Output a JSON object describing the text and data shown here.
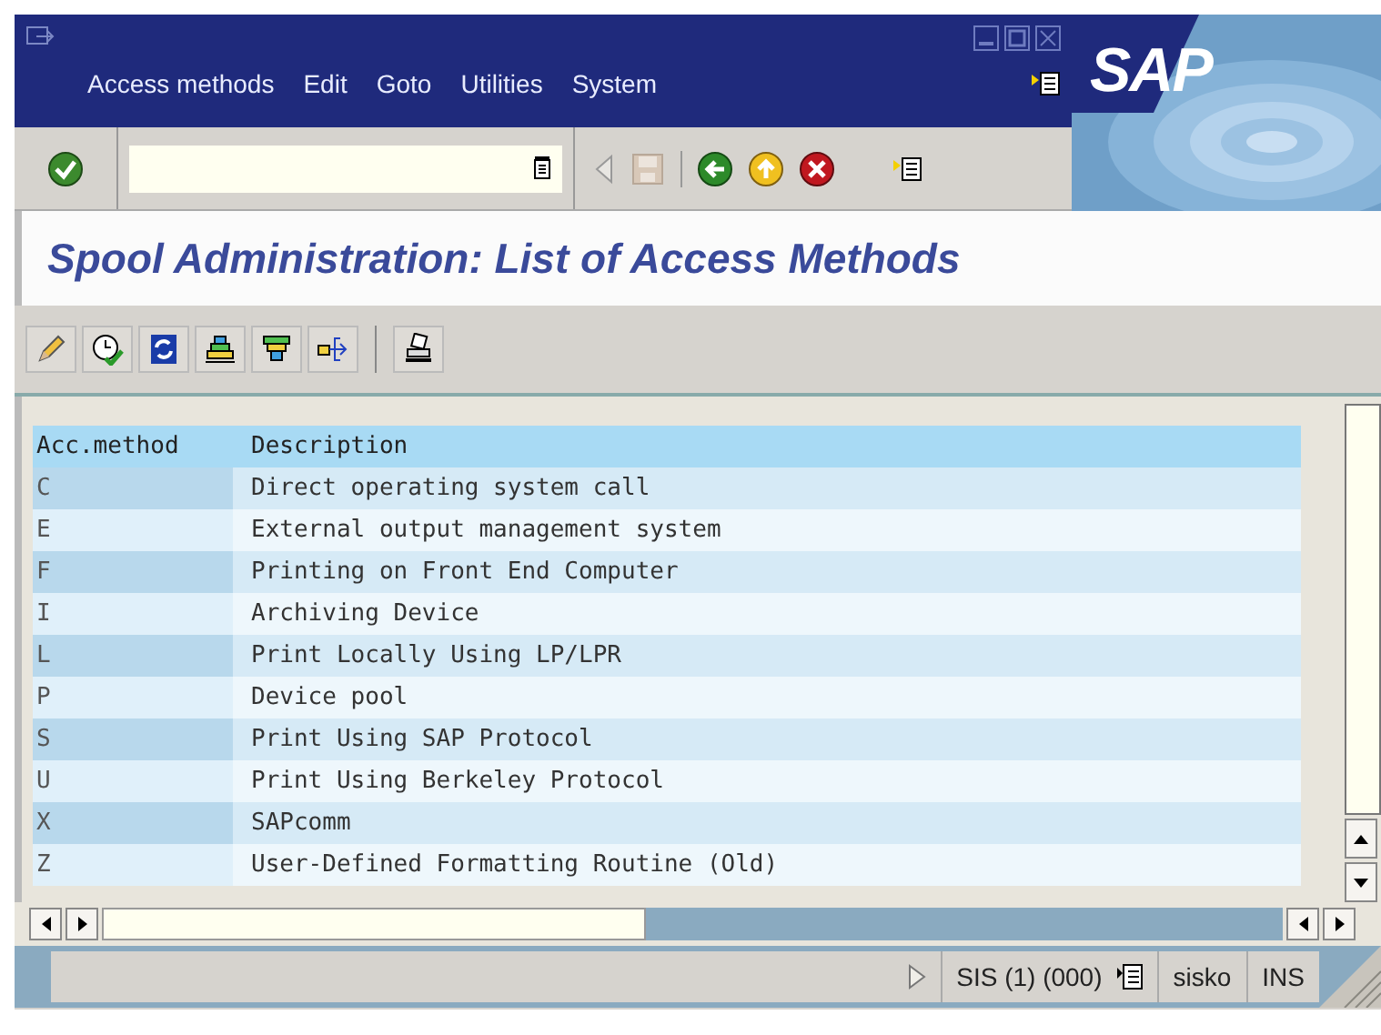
{
  "logo": "SAP",
  "menu": [
    "Access methods",
    "Edit",
    "Goto",
    "Utilities",
    "System"
  ],
  "title": "Spool Administration: List of Access Methods",
  "table": {
    "columns": [
      "Acc.method",
      "Description"
    ],
    "rows": [
      {
        "key": "C",
        "description": "Direct operating system call"
      },
      {
        "key": "E",
        "description": "External output management system"
      },
      {
        "key": "F",
        "description": "Printing on Front End Computer"
      },
      {
        "key": "I",
        "description": "Archiving Device"
      },
      {
        "key": "L",
        "description": "Print Locally Using LP/LPR"
      },
      {
        "key": "P",
        "description": "Device pool"
      },
      {
        "key": "S",
        "description": "Print Using SAP Protocol"
      },
      {
        "key": "U",
        "description": "Print Using Berkeley Protocol"
      },
      {
        "key": "X",
        "description": "SAPcomm"
      },
      {
        "key": "Z",
        "description": "User-Defined Formatting Routine (Old)"
      }
    ]
  },
  "status_bar": {
    "system": "SIS (1) (000)",
    "user": "sisko",
    "mode": "INS"
  }
}
